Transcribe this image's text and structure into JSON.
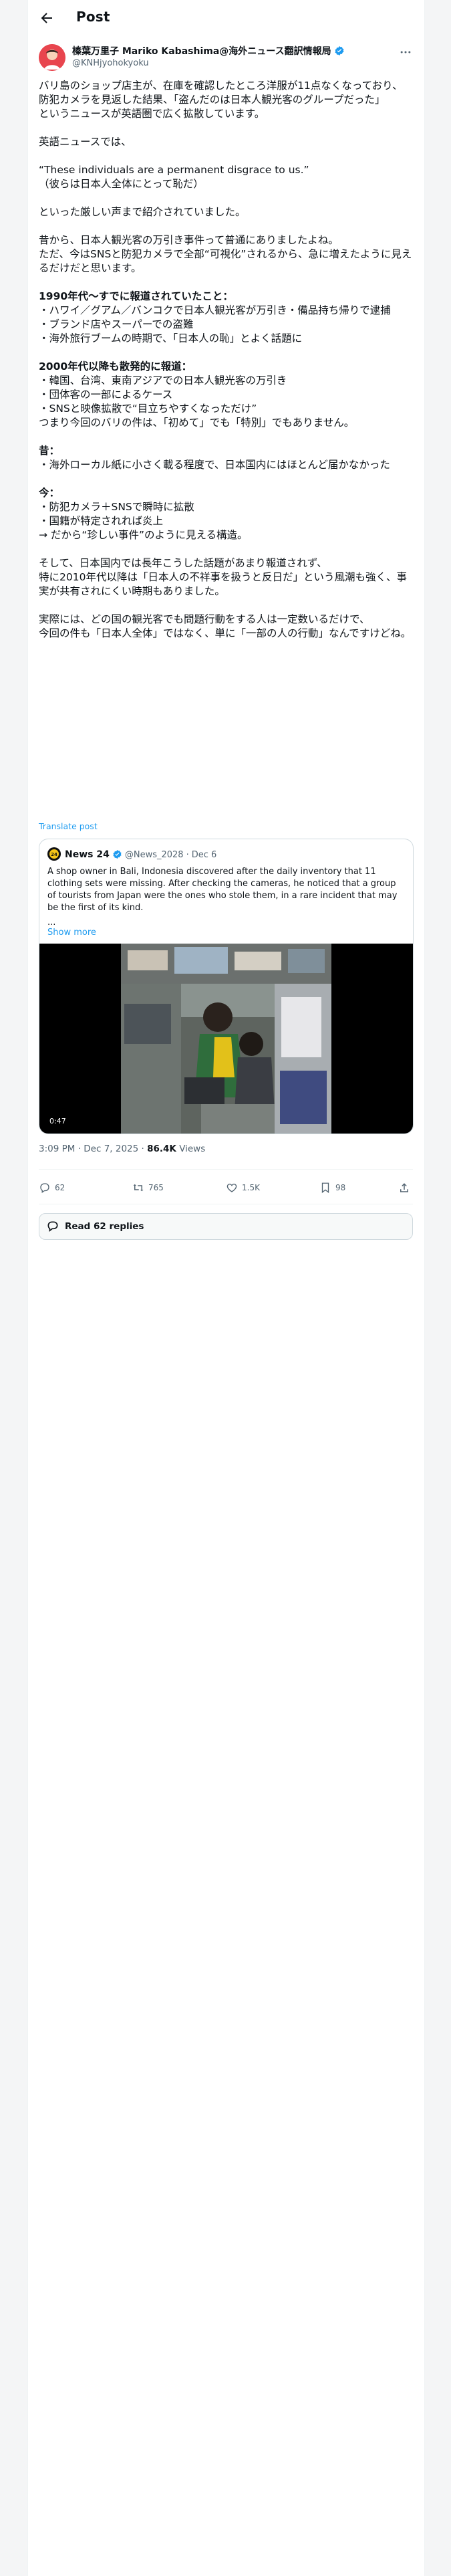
{
  "header": {
    "title": "Post"
  },
  "author": {
    "name": "榛葉万里子 Mariko Kabashima@海外ニュース翻訳情報局",
    "handle": "@KNHjyohokyoku"
  },
  "post": {
    "paragraphs": [
      "バリ島のショップ店主が、在庫を確認したところ洋服が11点なくなっており、\n防犯カメラを見返した結果、「盗んだのは日本人観光客のグループだった」\nというニュースが英語圏で広く拡散しています。",
      "英語ニュースでは、",
      "“These individuals are a permanent disgrace to us.”\n（彼らは日本人全体にとって恥だ）",
      "といった厳しい声まで紹介されていました。",
      "昔から、日本人観光客の万引き事件って普通にありましたよね。\nただ、今はSNSと防犯カメラで全部“可視化”されるから、急に増えたように見えるだけだと思います。"
    ],
    "section_1990_title": "1990年代〜すでに報道されていたこと：",
    "section_1990_items": [
      "・ハワイ／グアム／バンコクで日本人観光客が万引き・備品持ち帰りで逮捕",
      "・ブランド店やスーパーでの盗難",
      "・海外旅行ブームの時期で、「日本人の恥」とよく話題に"
    ],
    "section_2000_title": "2000年代以降も散発的に報道：",
    "section_2000_items": [
      "・韓国、台湾、東南アジアでの日本人観光客の万引き",
      "・団体客の一部によるケース",
      "・SNSと映像拡散で“目立ちやすくなっただけ”",
      "つまり今回のバリの件は、「初めて」でも「特別」でもありません。"
    ],
    "section_past_title": "昔：",
    "section_past_items": [
      "・海外ローカル紙に小さく載る程度で、日本国内にはほとんど届かなかった"
    ],
    "section_now_title": "今：",
    "section_now_items": [
      "・防犯カメラ＋SNSで瞬時に拡散",
      "・国籍が特定されれば炎上",
      "→ だから“珍しい事件”のように見える構造。"
    ],
    "closing_1": "そして、日本国内では長年こうした話題があまり報道されず、\n特に2010年代以降は「日本人の不祥事を扱うと反日だ」という風潮も強く、事実が共有されにくい時期もありました。",
    "closing_2": "実際には、どの国の観光客でも問題行動をする人は一定数いるだけで、\n今回の件も「日本人全体」ではなく、単に「一部の人の行動」なんですけどね。",
    "translate_label": "Translate post"
  },
  "quote": {
    "name": "News 24",
    "handle": "@News_2028",
    "date": "Dec 6",
    "text": "A shop owner in Bali, Indonesia discovered after the daily inventory that 11 clothing sets were missing. After checking the cameras, he noticed that a group of tourists from Japan were the ones who stole them, in a rare incident that may be the first of its kind.",
    "ellipsis": "...",
    "show_more": "Show more",
    "video_duration": "0:47"
  },
  "meta": {
    "time": "3:09 PM",
    "date": "Dec 7, 2025",
    "views_count": "86.4K",
    "views_label": "Views"
  },
  "actions": {
    "replies": "62",
    "reposts": "765",
    "likes": "1.5K",
    "bookmarks": "98"
  },
  "read_replies_label": "Read 62 replies",
  "colors": {
    "accent": "#1d9bf0",
    "avatar_bg": "#e8454e",
    "text_secondary": "#536471",
    "border": "#cfd9de"
  }
}
